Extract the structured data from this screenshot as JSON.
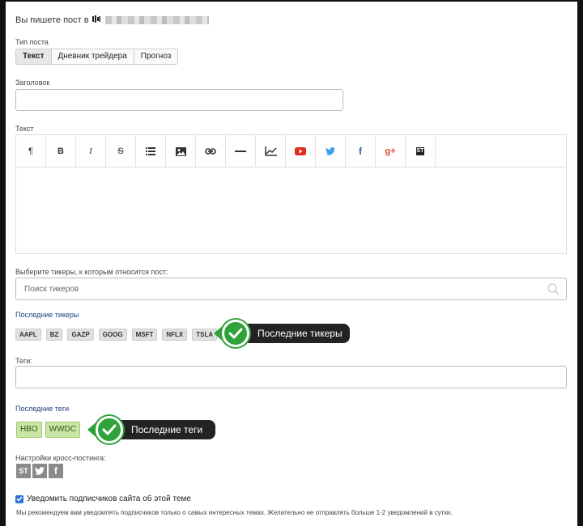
{
  "header": {
    "text": "Вы пишете пост в",
    "icon": "bars-icon"
  },
  "post_type": {
    "label": "Тип поста",
    "options": [
      "Текст",
      "Дневник трейдера",
      "Прогноз"
    ],
    "selected": "Текст"
  },
  "title_field": {
    "label": "Заголовок",
    "value": ""
  },
  "text_field": {
    "label": "Текст",
    "toolbar": [
      "paragraph-icon",
      "bold-icon",
      "italic-icon",
      "strikethrough-icon",
      "list-icon",
      "image-icon",
      "link-icon",
      "hr-icon",
      "chart-icon",
      "youtube-icon",
      "twitter-icon",
      "facebook-icon",
      "google-plus-icon",
      "stocktwits-icon"
    ],
    "bold": "B",
    "italic": "I",
    "strike": "S",
    "paragraph": "¶",
    "gplus": "g+",
    "facebook": "f",
    "st": "ST"
  },
  "tickers": {
    "label": "Выберите тикеры, к которым относится пост:",
    "placeholder": "Поиск тикеров",
    "recent_label": "Последние тикеры",
    "recent": [
      "AAPL",
      "BZ",
      "GAZP",
      "GOOG",
      "MSFT",
      "NFLX",
      "TSLA"
    ],
    "callout": "Последние тикеры"
  },
  "tags": {
    "label": "Теги:",
    "value": "",
    "recent_label": "Последние теги",
    "recent": [
      "HBO",
      "WWDC"
    ],
    "callout": "Последние теги"
  },
  "crosspost": {
    "label": "Настройки кросс-постинга:",
    "services": [
      "ST",
      "twitter-icon",
      "f"
    ]
  },
  "notify": {
    "checked": true,
    "label": "Уведомить подписчиков сайта об этой теме",
    "hint": "Мы рекомендуем вам уведомлять подписчиков только о самых интересных темах. Желательно не отправлять больше 1-2 уведомлений в сутки."
  },
  "colors": {
    "accent_green": "#2fa23a",
    "link_blue": "#1a3d7c",
    "youtube_red": "#e32b1d",
    "twitter_blue": "#3aa0e8",
    "facebook_blue": "#3b5ba5",
    "gplus_red": "#dd4b39"
  }
}
